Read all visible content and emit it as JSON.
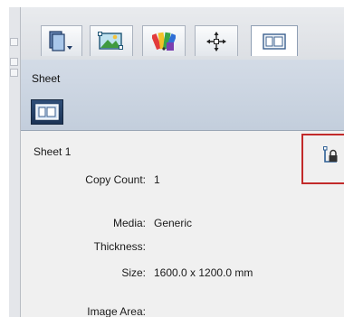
{
  "toolbar": {
    "buttons": [
      {
        "name": "pages-tool-button",
        "icon": "page-stack-dropdown-icon"
      },
      {
        "name": "image-tool-button",
        "icon": "image-landscape-icon"
      },
      {
        "name": "color-tool-button",
        "icon": "color-swatches-icon"
      },
      {
        "name": "position-tool-button",
        "icon": "move-crosshair-icon"
      },
      {
        "name": "sheet-tool-button",
        "icon": "sheet-layout-icon"
      }
    ]
  },
  "sheetbar": {
    "title": "Sheet"
  },
  "sheet": {
    "name": "Sheet 1",
    "lock_icon": "lock-icon",
    "fields": {
      "copy_count": {
        "label": "Copy Count:",
        "value": "1"
      },
      "media": {
        "label": "Media:",
        "value": "Generic"
      },
      "thickness": {
        "label": "Thickness:",
        "value": ""
      },
      "size": {
        "label": "Size:",
        "value": "1600.0 x 1200.0 mm"
      },
      "image_area": {
        "label": "Image Area:",
        "value": ""
      }
    }
  },
  "colors": {
    "highlight_border": "#c22a2a",
    "selected_tab": "#1d3557"
  }
}
